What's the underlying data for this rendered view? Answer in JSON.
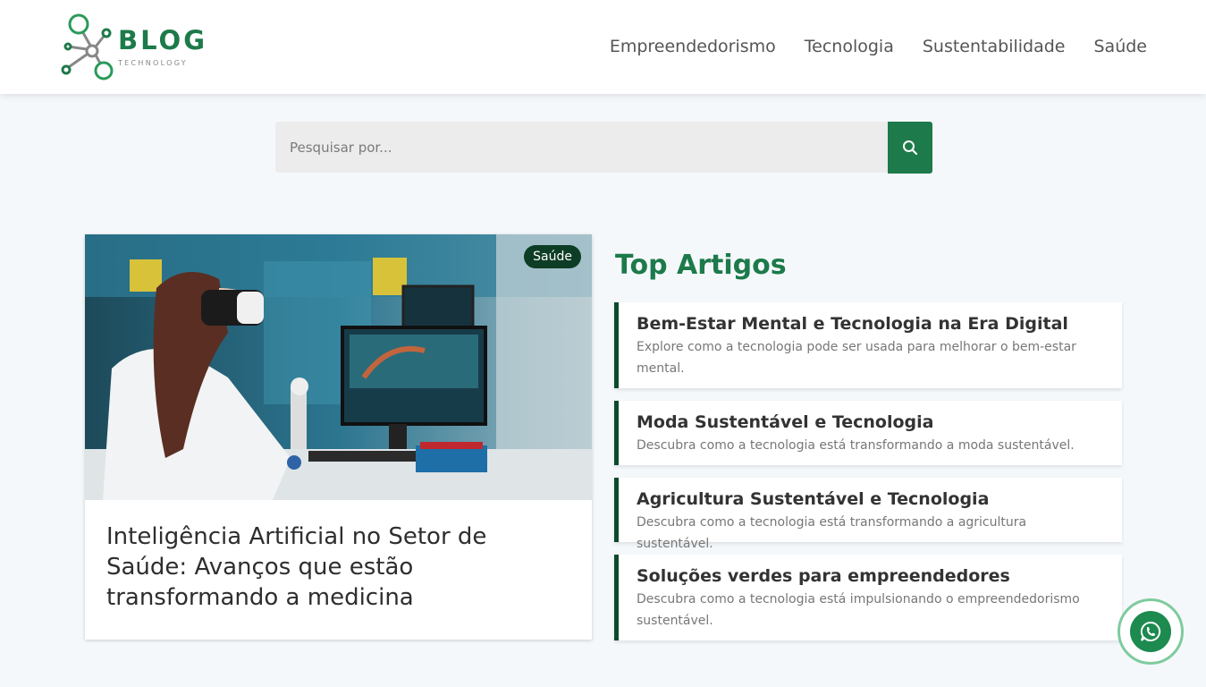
{
  "header": {
    "logo_word": "BLOG",
    "logo_sub": "TECHNOLOGY",
    "nav": [
      "Empreendedorismo",
      "Tecnologia",
      "Sustentabilidade",
      "Saúde"
    ]
  },
  "search": {
    "placeholder": "Pesquisar por...",
    "button_icon": "search-icon"
  },
  "featured": {
    "badge": "Saúde",
    "title": "Inteligência Artificial no Setor de Saúde: Avanços que estão transformando a medicina"
  },
  "top_articles": {
    "heading": "Top Artigos",
    "items": [
      {
        "title": "Bem-Estar Mental e Tecnologia na Era Digital",
        "desc": "Explore como a tecnologia pode ser usada para melhorar o bem-estar mental."
      },
      {
        "title": "Moda Sustentável e Tecnologia",
        "desc": "Descubra como a tecnologia está transformando a moda sustentável."
      },
      {
        "title": "Agricultura Sustentável e Tecnologia",
        "desc": "Descubra como a tecnologia está transformando a agricultura sustentável."
      },
      {
        "title": "Soluções verdes para empreendedores",
        "desc": "Descubra como a tecnologia está impulsionando o empreendedorismo sustentável."
      }
    ]
  },
  "whatsapp": {
    "icon": "whatsapp-icon"
  },
  "colors": {
    "brand": "#1d7a4a",
    "dark_green": "#0d4a2c",
    "search_bg": "#ececec",
    "page_bg": "#f5f8fb"
  }
}
